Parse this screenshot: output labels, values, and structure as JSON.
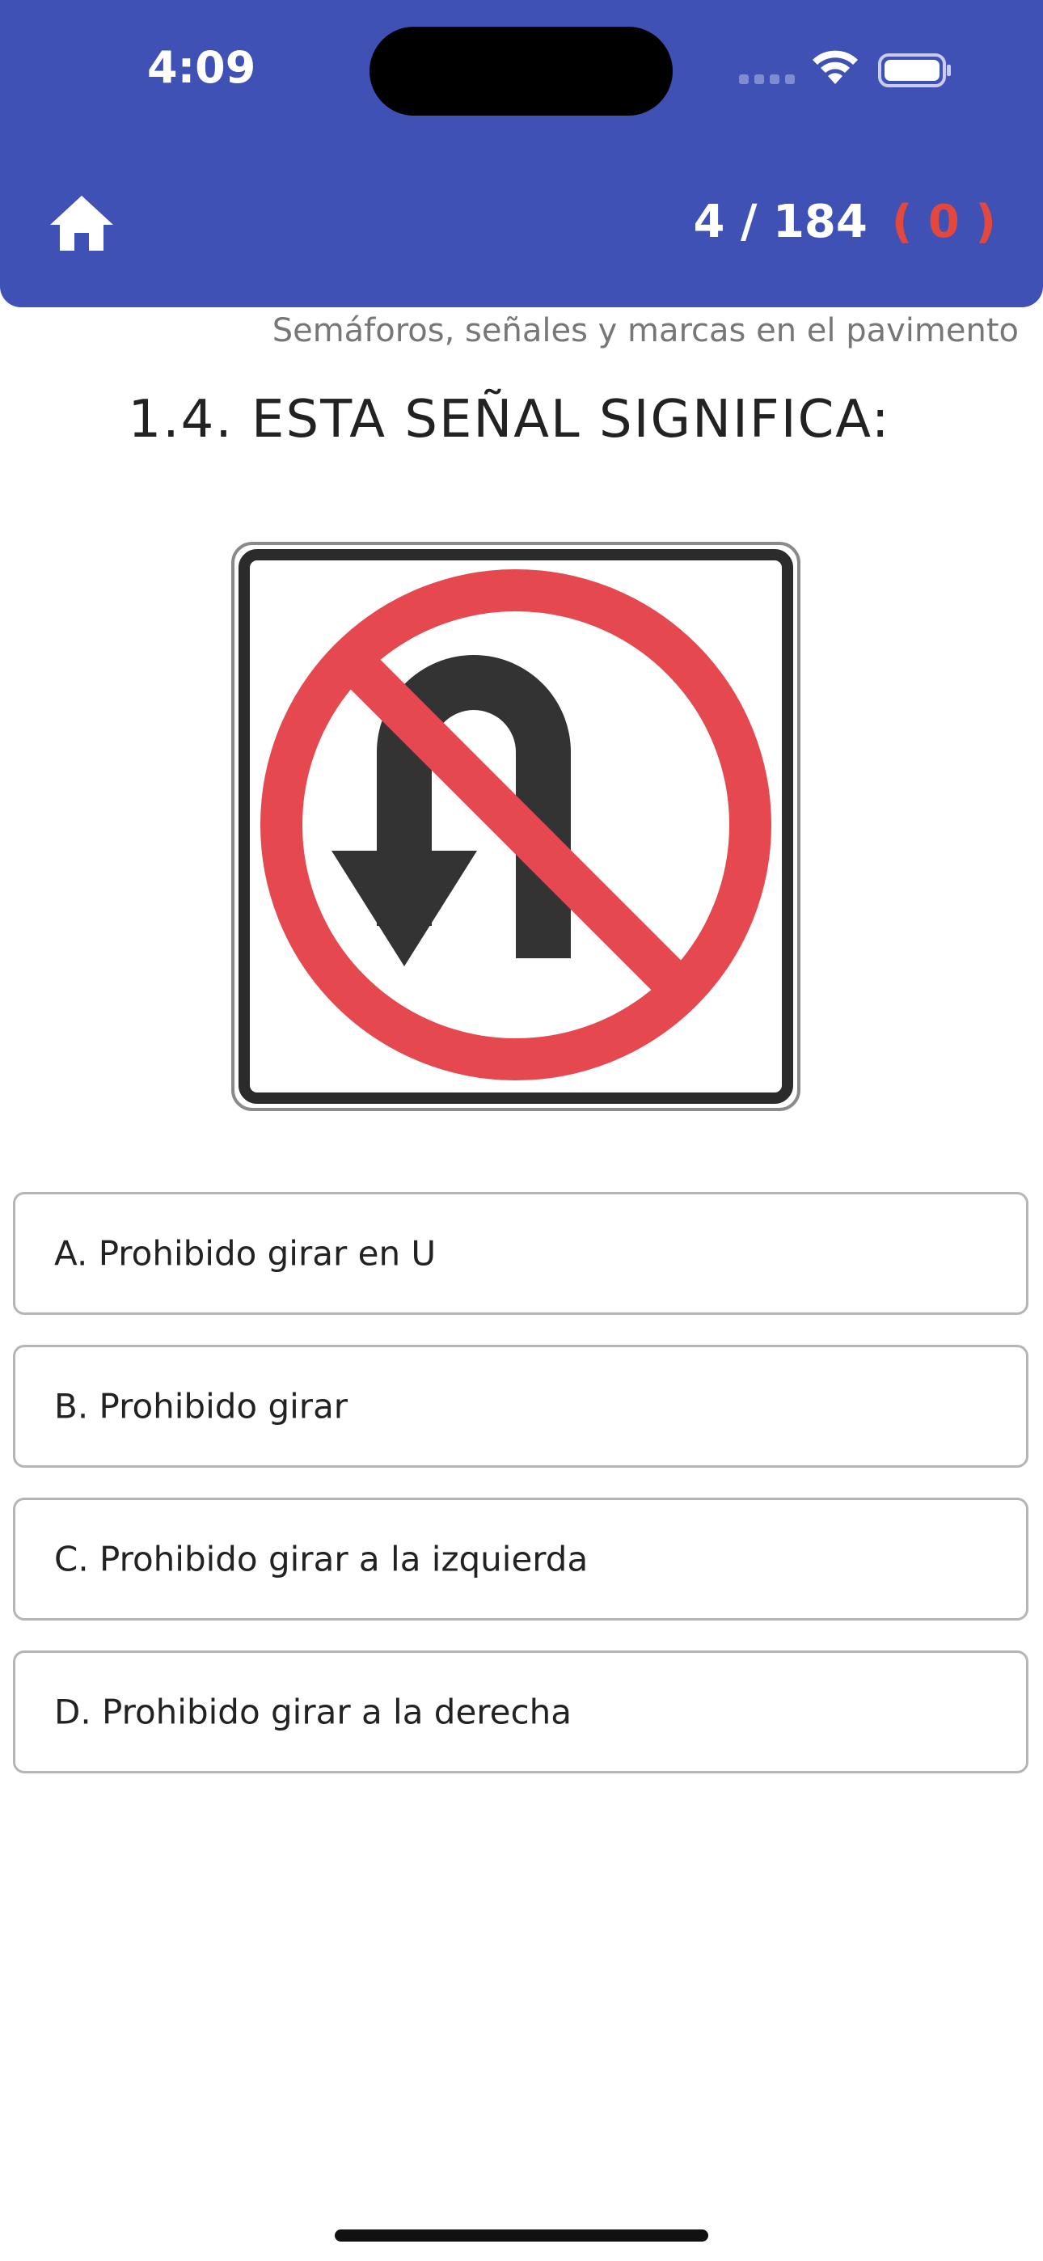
{
  "status_bar": {
    "time": "4:09"
  },
  "header": {
    "home_icon": "home-icon",
    "progress": "4 / 184",
    "errors": "( 0 )",
    "background_color": "#3f51b5",
    "error_color": "#e2483d"
  },
  "question": {
    "category": "Semáforos, señales y marcas en el pavimento",
    "title": "1.4. ESTA SEÑAL SIGNIFICA:",
    "image": "no-u-turn-sign"
  },
  "answers": [
    {
      "label": "A. Prohibido girar en U"
    },
    {
      "label": "B. Prohibido girar"
    },
    {
      "label": "C. Prohibido girar a la izquierda"
    },
    {
      "label": "D. Prohibido girar a la derecha"
    }
  ]
}
